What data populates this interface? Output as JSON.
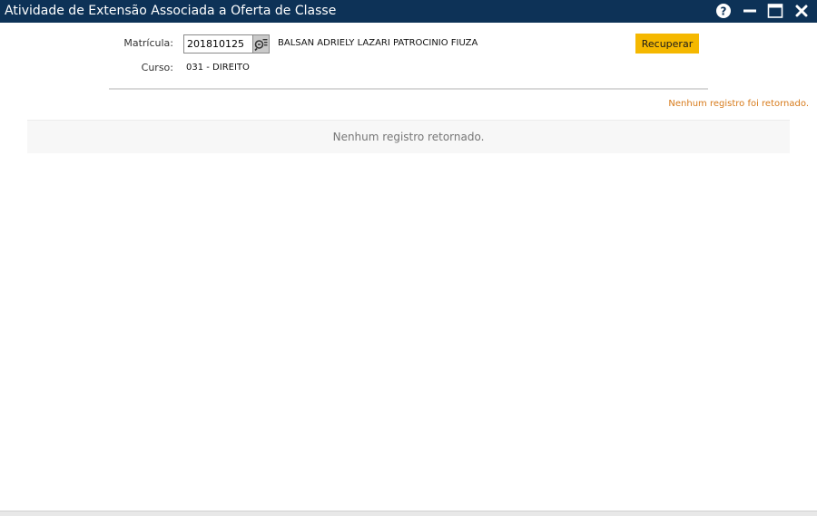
{
  "window": {
    "title": "Atividade de Extensão Associada a Oferta de Classe",
    "help_icon": "help-circle-icon",
    "minimize_icon": "minimize-icon",
    "maximize_icon": "maximize-icon",
    "close_icon": "close-icon",
    "bar_color": "#0d3257"
  },
  "form": {
    "matricula_label": "Matrícula:",
    "matricula_value": "201810125",
    "lookup_icon": "search-list-icon",
    "student_name": "BALSAN ADRIELY LAZARI PATROCINIO FIUZA",
    "curso_label": "Curso:",
    "curso_value": "031 - DIREITO",
    "recuperar_label": "Recuperar",
    "recuperar_color": "#f5b800"
  },
  "status": {
    "message": "Nenhum registro foi retornado.",
    "color": "#d77a1a"
  },
  "results": {
    "empty_message": "Nenhum registro retornado."
  }
}
